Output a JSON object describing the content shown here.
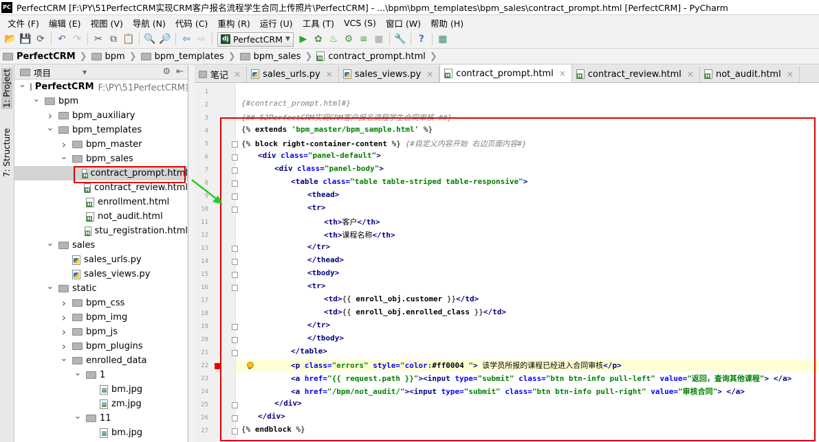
{
  "window": {
    "title": "PerfectCRM [F:\\PY\\51PerfectCRM实现CRM客户报名流程学生合同上传照片\\PerfectCRM] - ...\\bpm\\bpm_templates\\bpm_sales\\contract_prompt.html [PerfectCRM] - PyCharm",
    "logo": "PC"
  },
  "menu": [
    "文件 (F)",
    "编辑 (E)",
    "视图 (V)",
    "导航 (N)",
    "代码 (C)",
    "重构 (R)",
    "运行 (U)",
    "工具 (T)",
    "VCS (S)",
    "窗口 (W)",
    "帮助 (H)"
  ],
  "toolbar": {
    "run_config": "PerfectCRM",
    "run_config_icon": "dj"
  },
  "breadcrumb": [
    "PerfectCRM",
    "bpm",
    "bpm_templates",
    "bpm_sales",
    "contract_prompt.html"
  ],
  "side_tabs": {
    "project": "1: Project",
    "structure": "7: Structure"
  },
  "project_panel": {
    "title": "项目",
    "tree": [
      {
        "label": "PerfectCRM",
        "path": "F:\\PY\\51PerfectCRM实现C",
        "type": "folder",
        "level": 0,
        "expanded": true
      },
      {
        "label": "bpm",
        "type": "folder",
        "level": 1,
        "expanded": true
      },
      {
        "label": "bpm_auxiliary",
        "type": "folder",
        "level": 2,
        "expanded": false
      },
      {
        "label": "bpm_templates",
        "type": "folder",
        "level": 2,
        "expanded": true
      },
      {
        "label": "bpm_master",
        "type": "folder",
        "level": 3,
        "expanded": false
      },
      {
        "label": "bpm_sales",
        "type": "folder",
        "level": 3,
        "expanded": true
      },
      {
        "label": "contract_prompt.html",
        "type": "html",
        "level": 4,
        "selected": true
      },
      {
        "label": "contract_review.html",
        "type": "html",
        "level": 4
      },
      {
        "label": "enrollment.html",
        "type": "html",
        "level": 4
      },
      {
        "label": "not_audit.html",
        "type": "html",
        "level": 4
      },
      {
        "label": "stu_registration.html",
        "type": "html",
        "level": 4
      },
      {
        "label": "sales",
        "type": "folder",
        "level": 2,
        "expanded": true
      },
      {
        "label": "sales_urls.py",
        "type": "py",
        "level": 3
      },
      {
        "label": "sales_views.py",
        "type": "py",
        "level": 3
      },
      {
        "label": "static",
        "type": "folder",
        "level": 2,
        "expanded": true
      },
      {
        "label": "bpm_css",
        "type": "folder",
        "level": 3,
        "expanded": false
      },
      {
        "label": "bpm_img",
        "type": "folder",
        "level": 3,
        "expanded": false
      },
      {
        "label": "bpm_js",
        "type": "folder",
        "level": 3,
        "expanded": false
      },
      {
        "label": "bpm_plugins",
        "type": "folder",
        "level": 3,
        "expanded": false
      },
      {
        "label": "enrolled_data",
        "type": "folder",
        "level": 3,
        "expanded": true
      },
      {
        "label": "1",
        "type": "folder",
        "level": 4,
        "expanded": true
      },
      {
        "label": "bm.jpg",
        "type": "jpg",
        "level": 5
      },
      {
        "label": "zm.jpg",
        "type": "jpg",
        "level": 5
      },
      {
        "label": "11",
        "type": "folder",
        "level": 4,
        "expanded": true
      },
      {
        "label": "bm.jpg",
        "type": "jpg",
        "level": 5
      }
    ]
  },
  "editor_tabs": [
    {
      "label": "笔记",
      "type": "txt"
    },
    {
      "label": "sales_urls.py",
      "type": "py"
    },
    {
      "label": "sales_views.py",
      "type": "py"
    },
    {
      "label": "contract_prompt.html",
      "type": "html",
      "active": true
    },
    {
      "label": "contract_review.html",
      "type": "html"
    },
    {
      "label": "not_audit.html",
      "type": "html"
    }
  ],
  "line_numbers": [
    "1",
    "2",
    "3",
    "4",
    "5",
    "6",
    "7",
    "8",
    "9",
    "10",
    "11",
    "12",
    "13",
    "14",
    "15",
    "16",
    "17",
    "18",
    "19",
    "20",
    "21",
    "22",
    "23",
    "24",
    "25",
    "26",
    "27"
  ],
  "code_lines": [
    {
      "n": 2,
      "indent": 0,
      "parts": [
        [
          "cm",
          "{#contract_prompt.html#}"
        ]
      ]
    },
    {
      "n": 3,
      "indent": 0,
      "parts": [
        [
          "cm",
          "{## 52PerfectCRM实现CRM客户报名流程学生合同审核 ##}"
        ]
      ]
    },
    {
      "n": 4,
      "indent": 0,
      "parts": [
        [
          "tx",
          "{% "
        ],
        [
          "kw",
          "extends"
        ],
        [
          "tx",
          " "
        ],
        [
          "sv",
          "'bpm_master/bpm_sample.html'"
        ],
        [
          "tx",
          " %}"
        ]
      ]
    },
    {
      "n": 5,
      "indent": 0,
      "parts": [
        [
          "tx",
          "{% "
        ],
        [
          "kw",
          "block"
        ],
        [
          "tx",
          " "
        ],
        [
          "kw",
          "right-container-content"
        ],
        [
          "tx",
          " %} "
        ],
        [
          "cm",
          "{#自定义内容开始 右边页面内容#}"
        ]
      ]
    },
    {
      "n": 6,
      "indent": 1,
      "parts": [
        [
          "tg",
          "<div "
        ],
        [
          "at",
          "class="
        ],
        [
          "sv",
          "\"panel-default\""
        ],
        [
          "tg",
          ">"
        ]
      ]
    },
    {
      "n": 7,
      "indent": 2,
      "parts": [
        [
          "tg",
          "<div "
        ],
        [
          "at",
          "class="
        ],
        [
          "sv",
          "\"panel-body\""
        ],
        [
          "tg",
          ">"
        ]
      ]
    },
    {
      "n": 8,
      "indent": 3,
      "parts": [
        [
          "tg",
          "<table "
        ],
        [
          "at",
          "class="
        ],
        [
          "sv",
          "\"table table-striped table-responsive\""
        ],
        [
          "tg",
          ">"
        ]
      ]
    },
    {
      "n": 9,
      "indent": 4,
      "parts": [
        [
          "tg",
          "<thead>"
        ]
      ]
    },
    {
      "n": 10,
      "indent": 4,
      "parts": [
        [
          "tg",
          "<tr>"
        ]
      ]
    },
    {
      "n": 11,
      "indent": 5,
      "parts": [
        [
          "tg",
          "<th>"
        ],
        [
          "tx",
          "客户"
        ],
        [
          "tg",
          "</th>"
        ]
      ]
    },
    {
      "n": 12,
      "indent": 5,
      "parts": [
        [
          "tg",
          "<th>"
        ],
        [
          "tx",
          "课程名称"
        ],
        [
          "tg",
          "</th>"
        ]
      ]
    },
    {
      "n": 13,
      "indent": 4,
      "parts": [
        [
          "tg",
          "</tr>"
        ]
      ]
    },
    {
      "n": 14,
      "indent": 4,
      "parts": [
        [
          "tg",
          "</thead>"
        ]
      ]
    },
    {
      "n": 15,
      "indent": 4,
      "parts": [
        [
          "tg",
          "<tbody>"
        ]
      ]
    },
    {
      "n": 16,
      "indent": 4,
      "parts": [
        [
          "tg",
          "<tr>"
        ]
      ]
    },
    {
      "n": 17,
      "indent": 5,
      "parts": [
        [
          "tg",
          "<td>"
        ],
        [
          "tx",
          "{{ "
        ],
        [
          "kw",
          "enroll_obj.customer"
        ],
        [
          "tx",
          " }}"
        ],
        [
          "tg",
          "</td>"
        ]
      ]
    },
    {
      "n": 18,
      "indent": 5,
      "parts": [
        [
          "tg",
          "<td>"
        ],
        [
          "tx",
          "{{ "
        ],
        [
          "kw",
          "enroll_obj.enrolled_class"
        ],
        [
          "tx",
          " }}"
        ],
        [
          "tg",
          "</td>"
        ]
      ]
    },
    {
      "n": 19,
      "indent": 4,
      "parts": [
        [
          "tg",
          "</tr>"
        ]
      ]
    },
    {
      "n": 20,
      "indent": 4,
      "parts": [
        [
          "tg",
          "</tbody>"
        ]
      ]
    },
    {
      "n": 21,
      "indent": 3,
      "parts": [
        [
          "tg",
          "</table>"
        ]
      ]
    },
    {
      "n": 22,
      "indent": 3,
      "parts": [
        [
          "tg",
          "<p "
        ],
        [
          "at",
          "class="
        ],
        [
          "sv",
          "\"errors\" "
        ],
        [
          "at",
          "style="
        ],
        [
          "sv",
          "\""
        ],
        [
          "at",
          "color"
        ],
        [
          "sv",
          ":"
        ],
        [
          "kw",
          "#ff0004"
        ],
        [
          "sv",
          " \""
        ],
        [
          "tg",
          "> "
        ],
        [
          "tx",
          "该学员所报的课程已经进入合同审核"
        ],
        [
          "tg",
          "</p>"
        ]
      ]
    },
    {
      "n": 23,
      "indent": 3,
      "parts": [
        [
          "tg",
          "<a "
        ],
        [
          "at",
          "href="
        ],
        [
          "sv",
          "\"{{ request.path }}\""
        ],
        [
          "tg",
          "><input "
        ],
        [
          "at",
          "type="
        ],
        [
          "sv",
          "\"submit\" "
        ],
        [
          "at",
          "class="
        ],
        [
          "sv",
          "\"btn btn-info pull-left\" "
        ],
        [
          "at",
          "value="
        ],
        [
          "sv",
          "\"返回，查询其他课程\""
        ],
        [
          "tg",
          "> </a>"
        ]
      ]
    },
    {
      "n": 24,
      "indent": 3,
      "parts": [
        [
          "tg",
          "<a "
        ],
        [
          "at",
          "href="
        ],
        [
          "sv",
          "\"/bpm/not_audit/\""
        ],
        [
          "tg",
          "><input "
        ],
        [
          "at",
          "type="
        ],
        [
          "sv",
          "\"submit\" "
        ],
        [
          "at",
          "class="
        ],
        [
          "sv",
          "\"btn btn-info pull-right\" "
        ],
        [
          "at",
          "value="
        ],
        [
          "sv",
          "\"审核合同\""
        ],
        [
          "tg",
          "> </a>"
        ]
      ]
    },
    {
      "n": 25,
      "indent": 2,
      "parts": [
        [
          "tg",
          "</div>"
        ]
      ]
    },
    {
      "n": 26,
      "indent": 1,
      "parts": [
        [
          "tg",
          "</div>"
        ]
      ]
    },
    {
      "n": 27,
      "indent": 0,
      "parts": [
        [
          "tx",
          "{% "
        ],
        [
          "kw",
          "endblock"
        ],
        [
          "tx",
          " %}"
        ]
      ]
    }
  ],
  "colors": {
    "annotation_red": "#e00000",
    "annotation_green": "#22cc22",
    "selection": "#d4d4d4",
    "current_line": "#ffffd7"
  }
}
